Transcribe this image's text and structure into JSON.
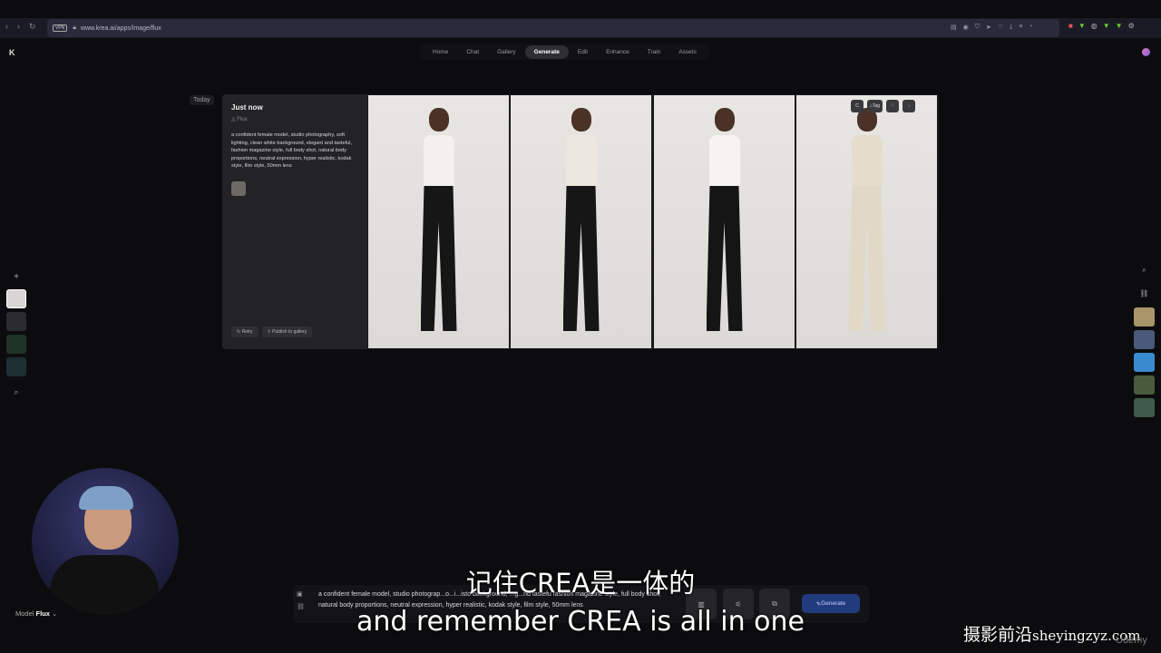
{
  "browser": {
    "url": "www.krea.ai/apps/image/flux",
    "vpn_label": "VPN"
  },
  "topnav": {
    "tabs": [
      {
        "label": "Home",
        "active": false
      },
      {
        "label": "Chat",
        "active": false
      },
      {
        "label": "Gallery",
        "active": false
      },
      {
        "label": "Generate",
        "active": true
      },
      {
        "label": "Edit",
        "active": false
      },
      {
        "label": "Enhance",
        "active": false
      },
      {
        "label": "Train",
        "active": false
      },
      {
        "label": "Assets",
        "active": false
      }
    ]
  },
  "feed": {
    "date_label": "Today",
    "card": {
      "title": "Just now",
      "model": "Flux",
      "prompt": "a confident female model, studio photography, soft lighting, clean white background, elegant and tasteful, fashion magazine style, full body shot, natural body proportions, neutral expression, hyper realistic, kodak style, film style, 50mm lens",
      "retry_label": "Retry",
      "publish_label": "Publish to gallery",
      "image_actions": {
        "copy": "C",
        "tag": "Tag"
      }
    },
    "images": [
      {
        "top": "#f3f1ee",
        "pants": "#161616"
      },
      {
        "top": "#ece8df",
        "pants": "#161616"
      },
      {
        "top": "#f6f4f0",
        "pants": "#151515"
      },
      {
        "top": "#e6dccb",
        "pants": "#e2d8c6"
      }
    ]
  },
  "model_selector": {
    "label": "Model",
    "value": "Flux"
  },
  "prompt_bar": {
    "text": "a confident female model, studio photograp...o...i...isto background, ...g...nd tastefu fashion magazine style, full body shot, natural body proportions, neutral expression, hyper realistic, kodak style, film style, 50mm lens",
    "generate_label": "Generate"
  },
  "subtitles": {
    "cn": "记住CREA是一体的",
    "en": "and remember CREA is all in one"
  },
  "watermark": {
    "cn": "摄影前沿",
    "site": "sheyingzyz.com"
  },
  "udemy": "Udemy",
  "colors": {
    "accent": "#223a7e",
    "background": "#0c0c0e"
  }
}
